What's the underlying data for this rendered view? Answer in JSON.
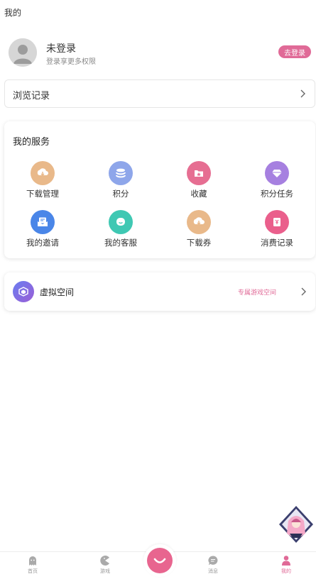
{
  "header": {
    "title": "我的"
  },
  "profile": {
    "name": "未登录",
    "subtitle": "登录享更多权限",
    "login_label": "去登录"
  },
  "history": {
    "label": "浏览记录"
  },
  "services": {
    "title": "我的服务",
    "items": [
      {
        "label": "下载管理",
        "icon": "download-icon",
        "color": "#e9b98a"
      },
      {
        "label": "积分",
        "icon": "coins-icon",
        "color": "#8ea6ea"
      },
      {
        "label": "收藏",
        "icon": "folder-star-icon",
        "color": "#e66e92"
      },
      {
        "label": "积分任务",
        "icon": "diamond-icon",
        "color": "#a680e0"
      },
      {
        "label": "我的邀请",
        "icon": "mail-icon",
        "color": "#4a86e8"
      },
      {
        "label": "我的客服",
        "icon": "chat-icon",
        "color": "#3fc8b3"
      },
      {
        "label": "下载券",
        "icon": "download-coupon-icon",
        "color": "#e9b98a"
      },
      {
        "label": "消费记录",
        "icon": "receipt-icon",
        "color": "#ea5f8c"
      }
    ]
  },
  "virtual": {
    "label": "虚拟空间",
    "tag": "专属游戏空间"
  },
  "tabs": [
    {
      "label": "首页",
      "icon": "ghost-icon"
    },
    {
      "label": "游戏",
      "icon": "pacman-icon"
    },
    {
      "label": "消息",
      "icon": "message-icon"
    },
    {
      "label": "我的",
      "icon": "user-icon",
      "active": true
    }
  ],
  "colors": {
    "accent": "#e06a97"
  }
}
